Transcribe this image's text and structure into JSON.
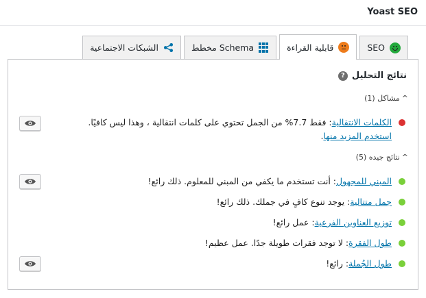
{
  "header": {
    "title": "Yoast SEO"
  },
  "tabs": [
    {
      "label": "SEO",
      "icon": "smiley-good-icon",
      "active": false
    },
    {
      "label": "قابلية القراءة",
      "icon": "smiley-ok-icon",
      "active": true
    },
    {
      "label": "مخطط Schema",
      "icon": "grid-icon",
      "active": false
    },
    {
      "label": "الشبكات الاجتماعية",
      "icon": "share-icon",
      "active": false
    }
  ],
  "analysis": {
    "title": "نتائج التحليل",
    "help_label": "?",
    "problems": {
      "label": "مشاكل (1)",
      "items": [
        {
          "link": "الكلمات الانتقالية",
          "text": ": فقط 7.7% من الجمل تحتوي على كلمات انتقالية ، وهذا ليس كافيًا. ",
          "extra_link": "استخدم المزيد منها",
          "extra_tail": "."
        }
      ]
    },
    "good": {
      "label": "نتائج جيده (5)",
      "items": [
        {
          "link": "المبني للمجهول",
          "text": ": أنت تستخدم ما يكفي من المبني للمعلوم. ذلك رائع!"
        },
        {
          "link": "جمل متتالية",
          "text": ": يوجد تنوع كافٍ في جملك. ذلك رائع!"
        },
        {
          "link": "توزيع العناوين الفرعية",
          "text": ": عمل رائع!"
        },
        {
          "link": "طول الفقرة",
          "text": ": لا توجد فقرات طويلة جدًا. عمل عظيم!"
        },
        {
          "link": "طول الجُملة",
          "text": ": رائع!"
        }
      ]
    }
  },
  "colors": {
    "problem_bullet": "#dc3232",
    "good_bullet": "#7ad03a",
    "link": "#0073aa",
    "smiley_good": "#22a83b",
    "smiley_ok": "#ee7c1b"
  }
}
